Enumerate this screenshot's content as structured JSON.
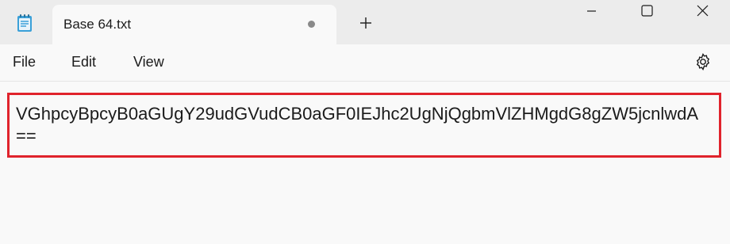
{
  "window": {
    "tab_title": "Base 64.txt",
    "tab_unsaved_indicator": "unsaved-dot"
  },
  "menu": {
    "file": "File",
    "edit": "Edit",
    "view": "View"
  },
  "icons": {
    "app": "notepad-icon",
    "new_tab": "plus-icon",
    "minimize": "minimize-icon",
    "maximize": "maximize-icon",
    "close": "close-icon",
    "settings": "gear-icon"
  },
  "editor": {
    "line1": "VGhpcyBpcyB0aGUgY29udGVudCB0aGF0IEJhc2UgNjQgbmVlZHMgdG8gZW5jcnlwdA",
    "line2": "=="
  },
  "colors": {
    "highlight_border": "#e0232c",
    "titlebar_bg": "#ececec",
    "editor_bg": "#f9f9f9"
  }
}
